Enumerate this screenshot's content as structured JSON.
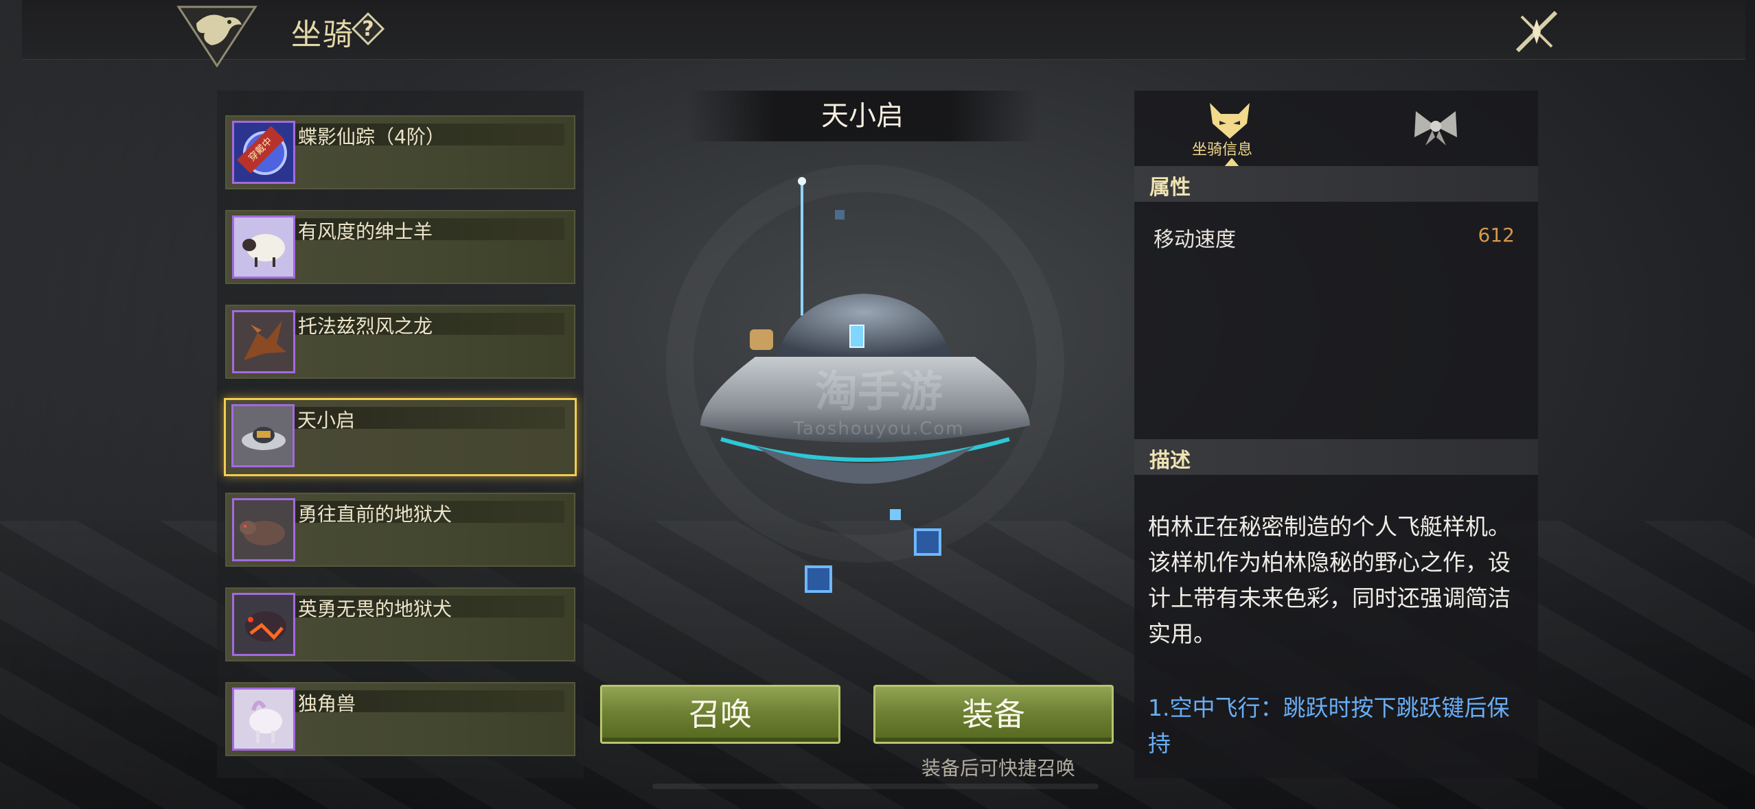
{
  "header": {
    "title": "坐骑",
    "help_icon": "question-icon",
    "close_icon": "close-icon"
  },
  "mount_list": [
    {
      "name": "蝶影仙踪（4阶）",
      "badge": "穿戴中",
      "selected": false
    },
    {
      "name": "有风度的绅士羊",
      "selected": false
    },
    {
      "name": "托法兹烈风之龙",
      "selected": false
    },
    {
      "name": "天小启",
      "selected": true
    },
    {
      "name": "勇往直前的地狱犬",
      "selected": false
    },
    {
      "name": "英勇无畏的地狱犬",
      "selected": false
    },
    {
      "name": "独角兽",
      "selected": false
    }
  ],
  "center": {
    "mount_name": "天小启",
    "watermark_big": "淘手游",
    "watermark_small": "Taoshouyou.Com",
    "summon_label": "召唤",
    "equip_label": "装备",
    "hint": "装备后可快捷召唤"
  },
  "info": {
    "tab_info_label": "坐骑信息",
    "attributes_header": "属性",
    "attributes": [
      {
        "name": "移动速度",
        "value": "612"
      }
    ],
    "description_header": "描述",
    "description": "柏林正在秘密制造的个人飞艇样机。该样机作为柏林隐秘的野心之作，设计上带有未来色彩，同时还强调简洁实用。",
    "skill": "1.空中飞行：跳跃时按下跳跃键后保持"
  },
  "colors": {
    "accent_gold": "#f3cd4f",
    "value_orange": "#d79a4a",
    "skill_blue": "#69aef5",
    "button_green": "#6e8134",
    "thumb_border_purple": "#a36ae0"
  }
}
